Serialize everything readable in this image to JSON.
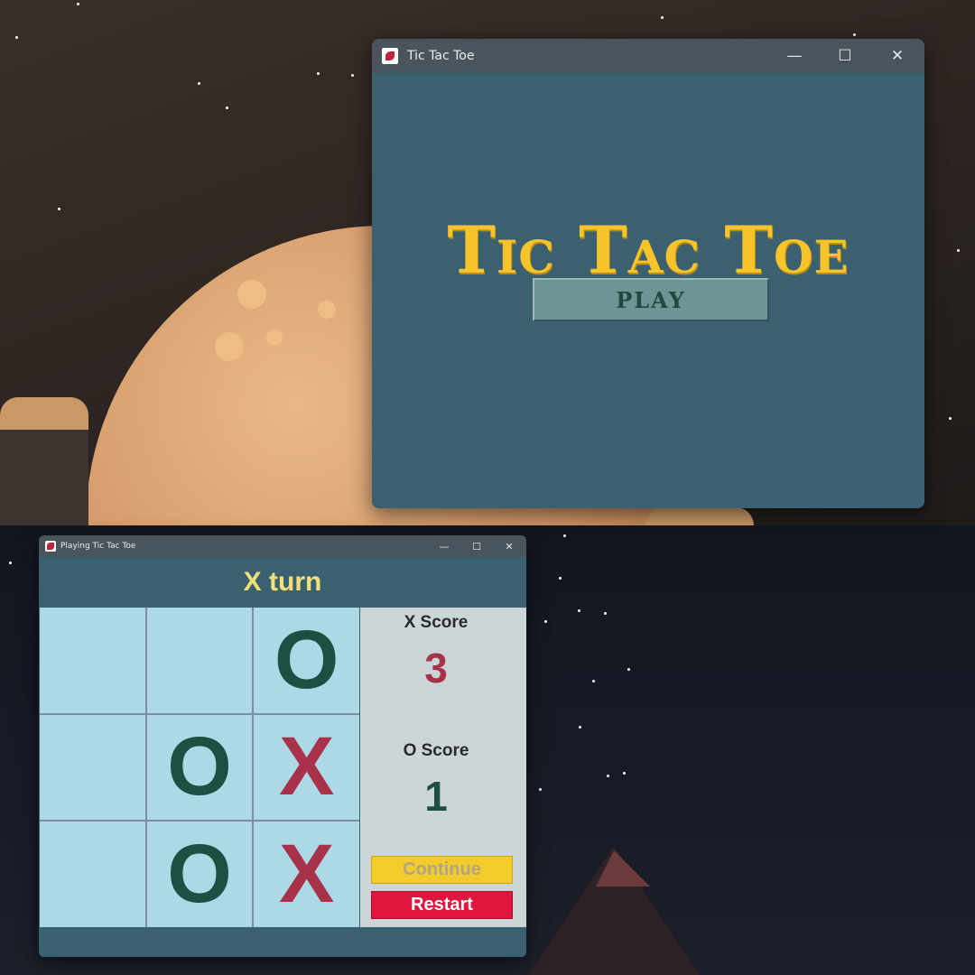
{
  "menu_window": {
    "title": "Tic Tac Toe",
    "heading": "Tic Tac Toe",
    "play_label": "PLAY",
    "controls": {
      "minimize": "—",
      "maximize": "☐",
      "close": "✕"
    }
  },
  "game_window": {
    "title": "Playing Tic Tac Toe",
    "turn_text": "X turn",
    "board": [
      [
        "",
        "",
        "O"
      ],
      [
        "",
        "O",
        "X"
      ],
      [
        "",
        "O",
        "X"
      ]
    ],
    "scores": {
      "x_label": "X Score",
      "x_value": "3",
      "o_label": "O Score",
      "o_value": "1"
    },
    "continue_label": "Continue",
    "restart_label": "Restart",
    "controls": {
      "minimize": "—",
      "maximize": "☐",
      "close": "✕"
    }
  },
  "colors": {
    "window_bg": "#3b6171",
    "titlebar": "#4a545d",
    "heading_gold": "#f7c52b",
    "cell_bg": "#add8e6",
    "x_mark": "#a8324a",
    "o_mark": "#1f4e42",
    "continue_bg": "#f2cc2a",
    "restart_bg": "#e1163f"
  }
}
